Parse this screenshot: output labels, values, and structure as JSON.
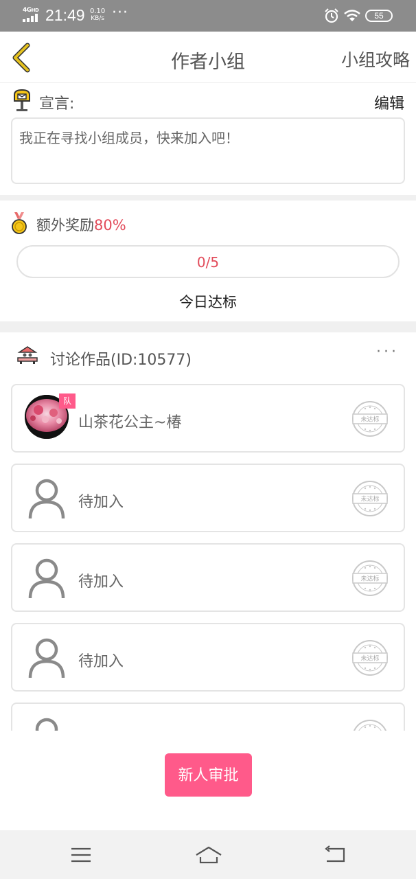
{
  "status_bar": {
    "network": "4G",
    "network_suffix": "HD",
    "time": "21:49",
    "speed_value": "0.10",
    "speed_unit": "KB/s",
    "more": "···",
    "battery": "55",
    "icons": [
      "signal-icon",
      "alarm-icon",
      "wifi-icon",
      "battery-icon"
    ]
  },
  "header": {
    "back_icon": "chevron-left-icon",
    "title": "作者小组",
    "right_action": "小组攻略"
  },
  "declaration": {
    "icon": "mailbox-icon",
    "label": "宣言:",
    "edit_label": "编辑",
    "text": "我正在寻找小组成员，快来加入吧！"
  },
  "reward": {
    "icon": "medal-icon",
    "label": "额外奖励",
    "percent": "80%",
    "progress_text": "0/5",
    "progress_fraction": 0,
    "subtitle": "今日达标"
  },
  "discussion": {
    "icon": "stage-icon",
    "title": "讨论作品(ID:10577)",
    "more": "···",
    "members": [
      {
        "name": "山茶花公主~椿",
        "badge": "队",
        "has_avatar": true,
        "stamp": "未达标"
      },
      {
        "name": "待加入",
        "has_avatar": false,
        "stamp": "未达标"
      },
      {
        "name": "待加入",
        "has_avatar": false,
        "stamp": "未达标"
      },
      {
        "name": "待加入",
        "has_avatar": false,
        "stamp": "未达标"
      },
      {
        "name": "",
        "has_avatar": false,
        "stamp": ""
      }
    ]
  },
  "actions": {
    "approve_button": "新人审批"
  },
  "system_nav": {
    "icons": [
      "menu-icon",
      "home-icon",
      "back-icon"
    ]
  },
  "colors": {
    "accent": "#ff5a8a",
    "highlight": "#e24b5a",
    "back_chevron": "#c9a227",
    "status_bar": "#8c8c8c"
  }
}
